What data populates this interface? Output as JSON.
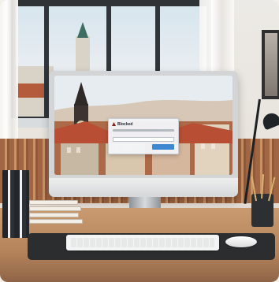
{
  "monitor": {
    "dialog": {
      "title": "Blocked"
    }
  }
}
